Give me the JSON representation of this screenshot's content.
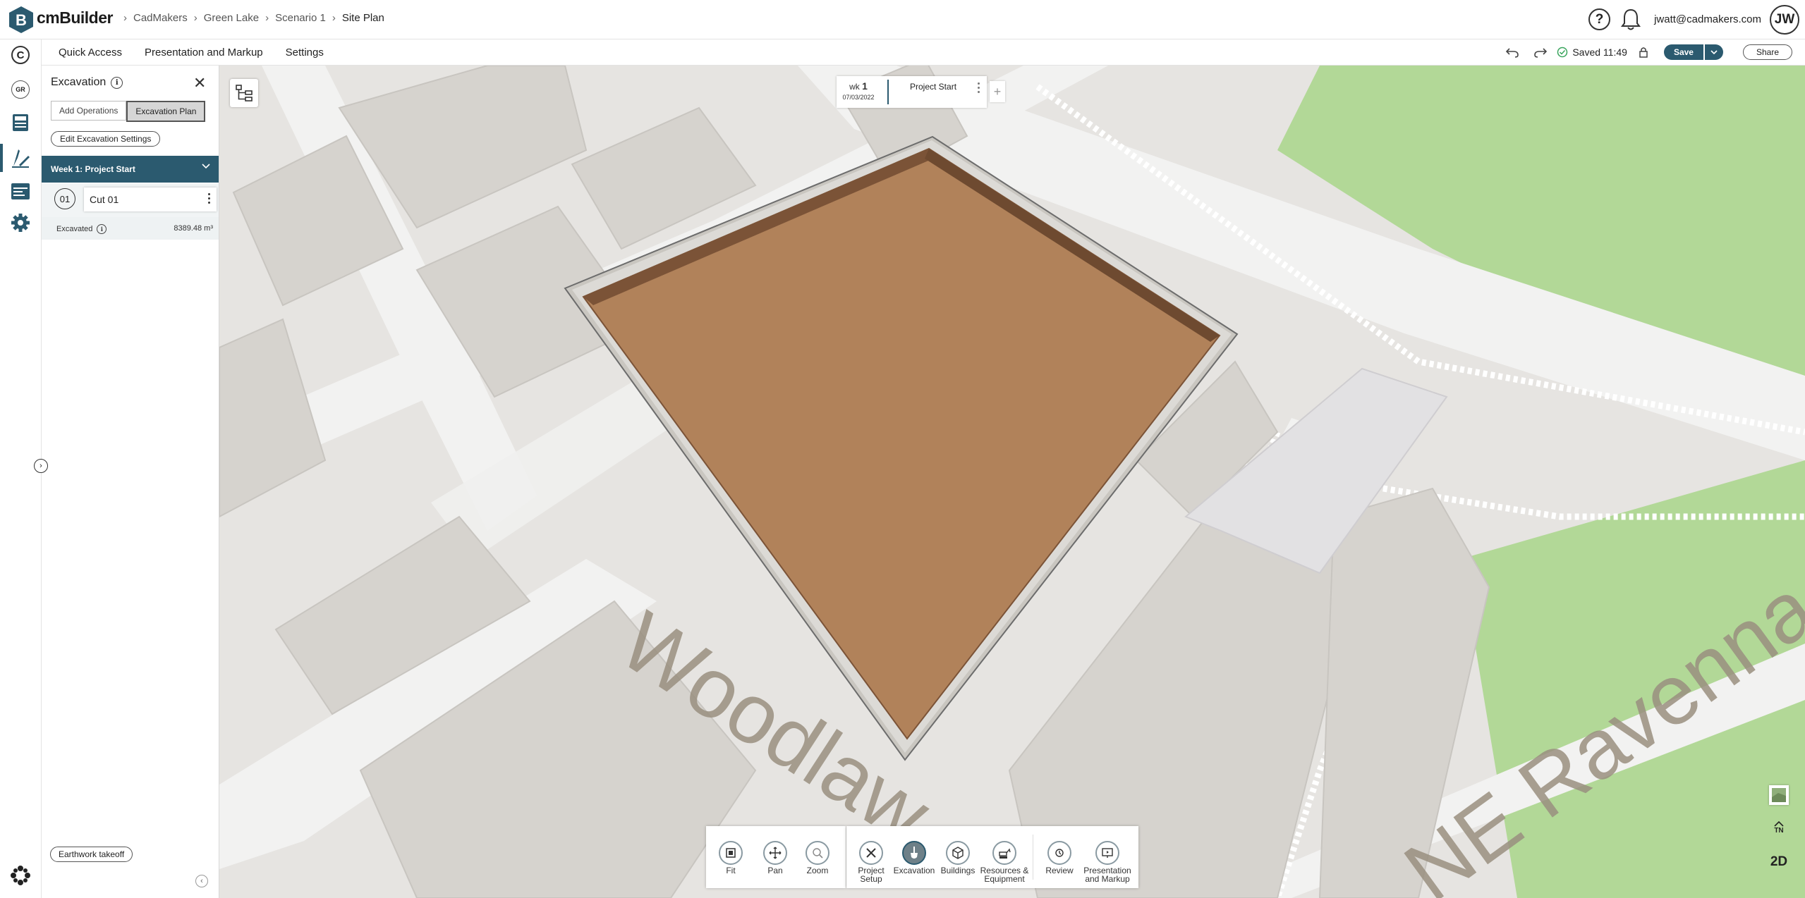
{
  "app": {
    "brand": "cmBuilder",
    "breadcrumbs": [
      "CadMakers",
      "Green Lake",
      "Scenario 1",
      "Site Plan"
    ]
  },
  "header": {
    "help_icon": "question-icon",
    "notif_icon": "bell-icon",
    "user_email": "jwatt@cadmakers.com",
    "avatar_initials": "JW"
  },
  "menubar": {
    "items": [
      "Quick Access",
      "Presentation and Markup",
      "Settings"
    ],
    "saved_text": "Saved 11:49",
    "save_label": "Save",
    "share_label": "Share"
  },
  "rail": {
    "items": [
      {
        "name": "c-logo-icon",
        "text": "C"
      },
      {
        "name": "gr-badge",
        "text": "GR"
      },
      {
        "name": "calculator-icon",
        "text": ""
      },
      {
        "name": "design-tool-icon",
        "text": ""
      },
      {
        "name": "schedule-icon",
        "text": ""
      },
      {
        "name": "gear-icon",
        "text": ""
      },
      {
        "name": "network-icon",
        "text": ""
      }
    ]
  },
  "panel": {
    "title": "Excavation",
    "tabs": [
      "Add Operations",
      "Excavation Plan"
    ],
    "active_tab": "Excavation Plan",
    "edit_settings_label": "Edit Excavation Settings",
    "week_header": "Week 1: Project Start",
    "cut": {
      "number": "01",
      "name": "Cut 01"
    },
    "excavated_label": "Excavated",
    "excavated_value": "8389.48 m³",
    "earthwork_label": "Earthwork takeoff"
  },
  "timeline": {
    "wk_label": "wk",
    "wk_num": "1",
    "date": "07/03/2022",
    "phase": "Project Start",
    "add": "+"
  },
  "map": {
    "street_1": "Woodlaw",
    "street_2": "NE Ravenna",
    "colors": {
      "ground": "#e6e4e1",
      "building": "#d6d3ce",
      "road": "#f2f2f1",
      "park": "#b2d897",
      "pit": "#b1825a",
      "pit_edge": "#7b5337"
    }
  },
  "toolbar_left": [
    {
      "label": "Fit",
      "icon": "fit-icon"
    },
    {
      "label": "Pan",
      "icon": "pan-icon"
    },
    {
      "label": "Zoom",
      "icon": "zoom-icon"
    }
  ],
  "toolbar_main": [
    {
      "label1": "Project",
      "label2": "Setup",
      "icon": "tools-icon"
    },
    {
      "label1": "Excavation",
      "label2": "",
      "icon": "shovel-icon"
    },
    {
      "label1": "Buildings",
      "label2": "",
      "icon": "building-icon"
    },
    {
      "label1": "Resources &",
      "label2": "Equipment",
      "icon": "excavator-icon"
    },
    {
      "label1": "Review",
      "label2": "",
      "icon": "review-icon"
    },
    {
      "label1": "Presentation",
      "label2": "and Markup",
      "icon": "presentation-icon"
    }
  ],
  "corner": {
    "north_label": "TN",
    "view_mode": "2D"
  }
}
